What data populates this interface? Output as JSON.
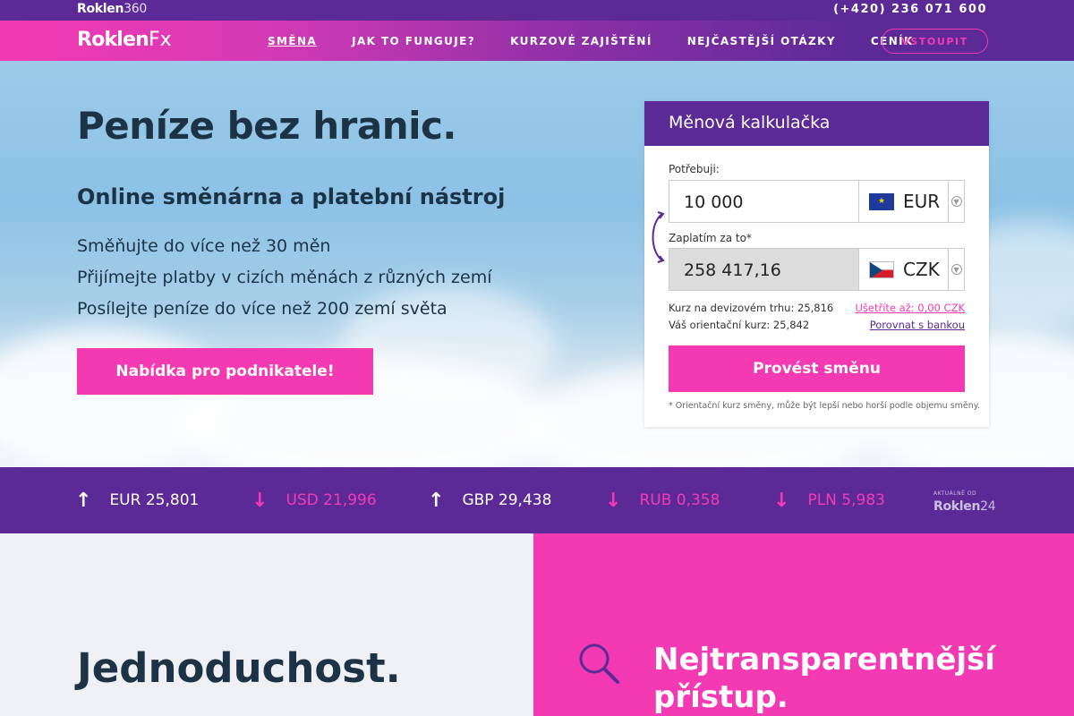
{
  "topbar": {
    "brand_bold": "Roklen",
    "brand_light": "360",
    "phone": "(+420) 236 071 600"
  },
  "nav": {
    "logo_bold": "Roklen",
    "logo_light": "Fx",
    "items": [
      {
        "label": "SMĚNA"
      },
      {
        "label": "JAK TO FUNGUJE?"
      },
      {
        "label": "KURZOVÉ ZAJIŠTĚNÍ"
      },
      {
        "label": "NEJČASTĚJŠÍ OTÁZKY"
      },
      {
        "label": "CENÍK"
      }
    ],
    "login_label": "VSTOUPIT"
  },
  "hero": {
    "title": "Peníze bez hranic.",
    "subtitle": "Online směnárna a platební nástroj",
    "lines": [
      "Směňujte do více než 30 měn",
      "Přijímejte platby v cizích měnách z různých zemí",
      "Posílejte peníze do více než 200 zemí světa"
    ],
    "cta_label": "Nabídka pro podnikatele!"
  },
  "calculator": {
    "title": "Měnová kalkulačka",
    "need_label": "Potřebuji:",
    "need_amount": "10 000",
    "need_currency": "EUR",
    "pay_label": "Zaplatím za to*",
    "pay_amount": "258 417,16",
    "pay_currency": "CZK",
    "market_rate_label": "Kurz na devizovém trhu:",
    "market_rate": "25,816",
    "save_link": "Ušetříte až: 0,00 CZK",
    "your_rate_label": "Váš orientační kurz:",
    "your_rate": "25,842",
    "compare_link": "Porovnat s bankou",
    "submit_label": "Provést směnu",
    "note": "* Orientační kurz směny, může být lepší nebo horší podle objemu směny."
  },
  "ticker": {
    "items": [
      {
        "text": "EUR 25,801",
        "direction": "up",
        "arrow": "↑"
      },
      {
        "text": "USD 21,996",
        "direction": "down",
        "arrow": "↓"
      },
      {
        "text": "GBP 29,438",
        "direction": "up",
        "arrow": "↑"
      },
      {
        "text": "RUB 0,358",
        "direction": "down",
        "arrow": "↓"
      },
      {
        "text": "PLN 5,983",
        "direction": "down",
        "arrow": "↓"
      }
    ],
    "source_small": "AKTUÁLNĚ OD",
    "source_bold": "Roklen",
    "source_light": "24"
  },
  "sections": {
    "left_title": "Jednoduchost.",
    "right_title_1": "Nejtransparentnější",
    "right_title_2": "přístup."
  },
  "colors": {
    "purple": "#5b2a97",
    "pink": "#f43ab3",
    "navy": "#1c3346"
  },
  "icons": {
    "search": "magnifier-icon"
  }
}
